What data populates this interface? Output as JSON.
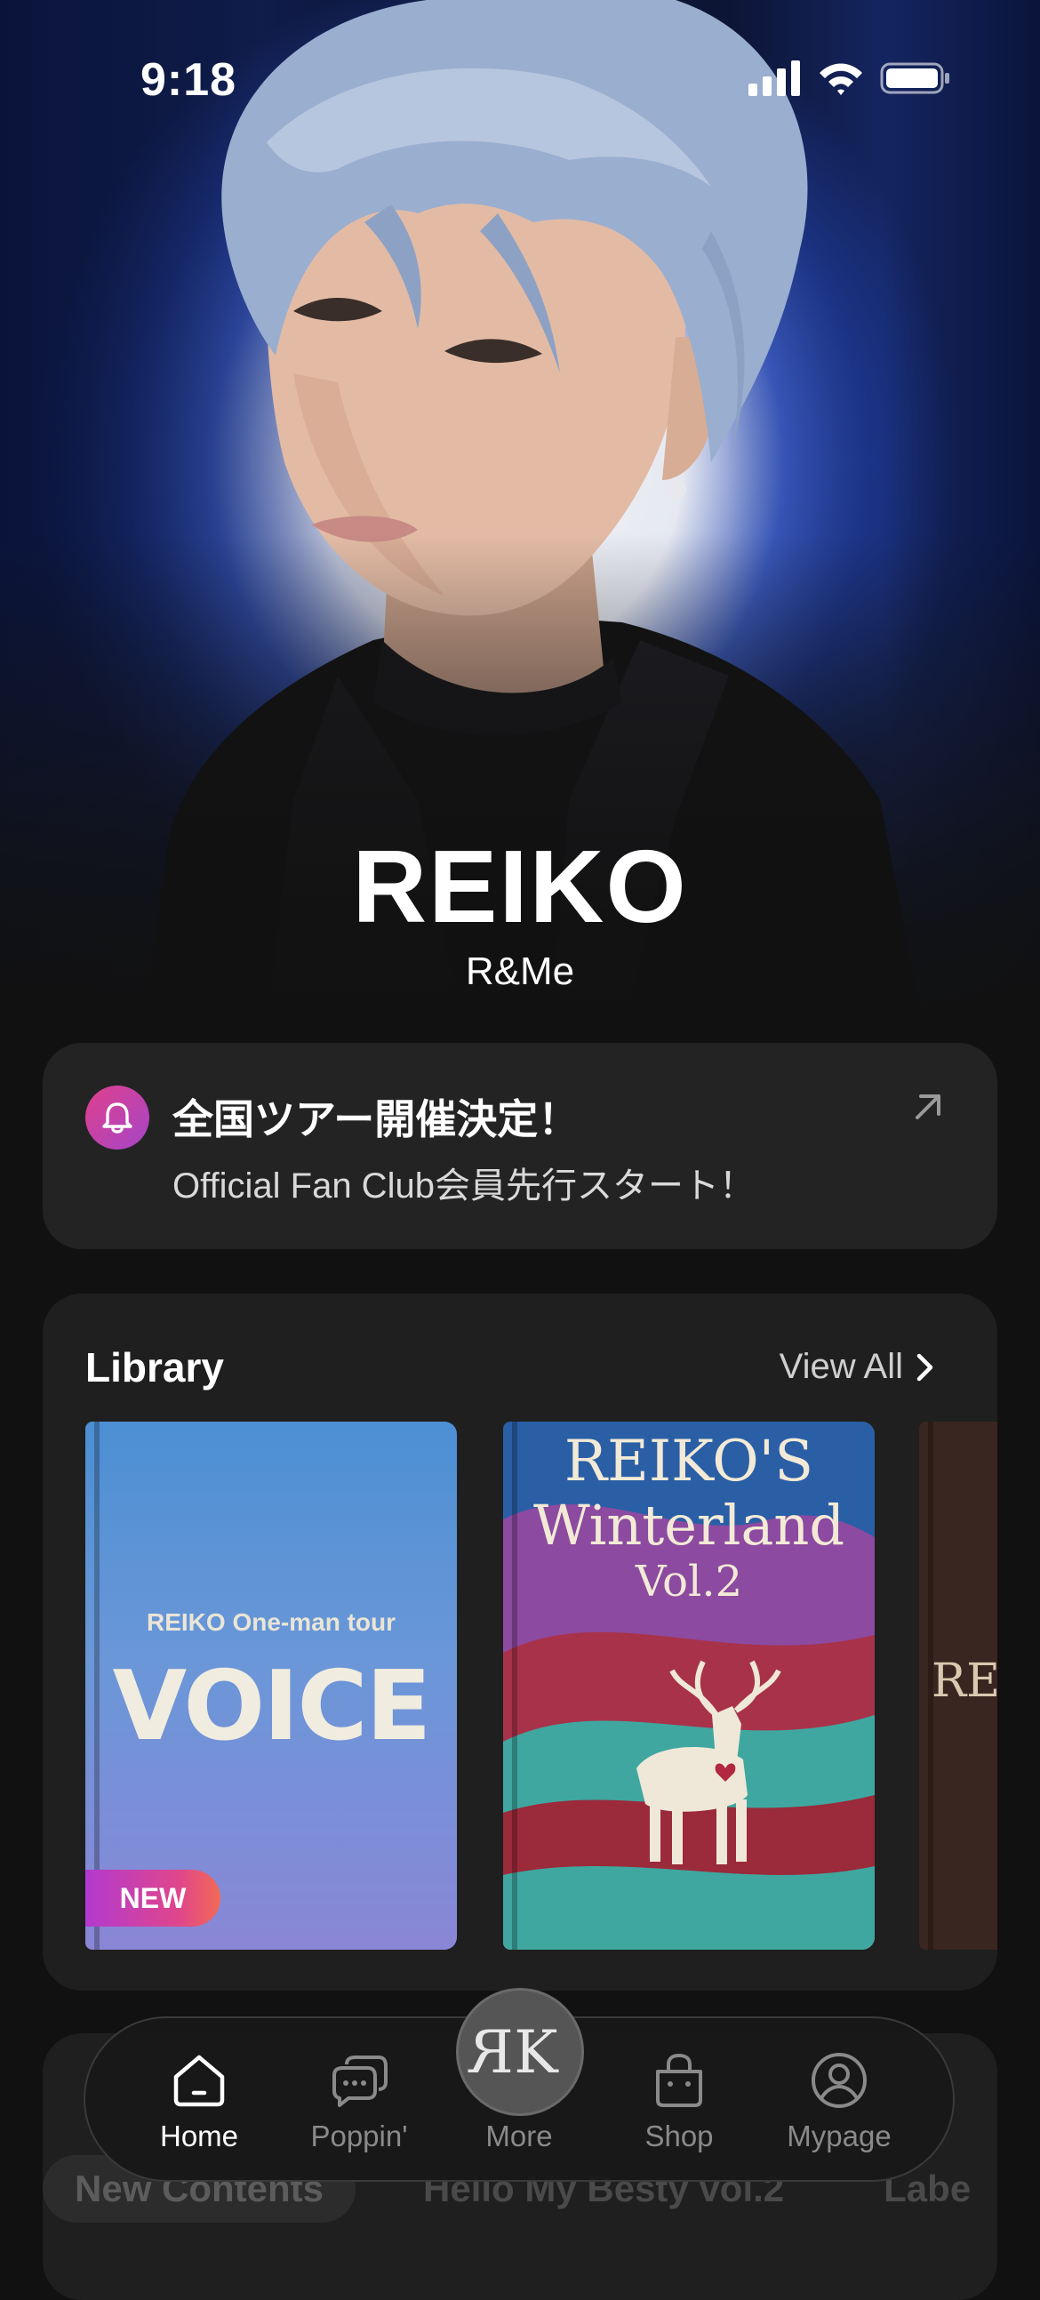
{
  "status_bar": {
    "time": "9:18"
  },
  "hero": {
    "artist_name": "REIKO",
    "subtitle": "R&Me"
  },
  "announcement": {
    "title": "全国ツアー開催決定！",
    "body": "Official Fan Club会員先行スタート！",
    "icon": "bell-icon",
    "action_icon": "arrow-up-right-icon"
  },
  "library": {
    "title": "Library",
    "view_all_label": "View All",
    "books": [
      {
        "subtitle": "REIKO One-man tour",
        "title": "VOICE",
        "badge": "NEW"
      },
      {
        "title_line1": "REIKO'S",
        "title_line2": "Winterland",
        "title_line3": "Vol.2"
      },
      {
        "title_partial": "RE"
      }
    ]
  },
  "contents": {
    "chips": [
      "New Contents",
      "Hello My Besty vol.2",
      "Labe"
    ]
  },
  "tabbar": {
    "items": [
      {
        "label": "Home",
        "icon": "home-icon",
        "active": true
      },
      {
        "label": "Poppin'",
        "icon": "chat-bubbles-icon",
        "active": false
      },
      {
        "label": "More",
        "icon": "rk-logo",
        "active": false
      },
      {
        "label": "Shop",
        "icon": "shopping-bag-icon",
        "active": false
      },
      {
        "label": "Mypage",
        "icon": "user-icon",
        "active": false
      }
    ],
    "center_monogram": "RK"
  },
  "colors": {
    "background": "#111111",
    "card": "#232323",
    "badge_gradient_start": "#b23ad0",
    "badge_gradient_end": "#f26a55",
    "accent_pink": "#e0408c"
  }
}
